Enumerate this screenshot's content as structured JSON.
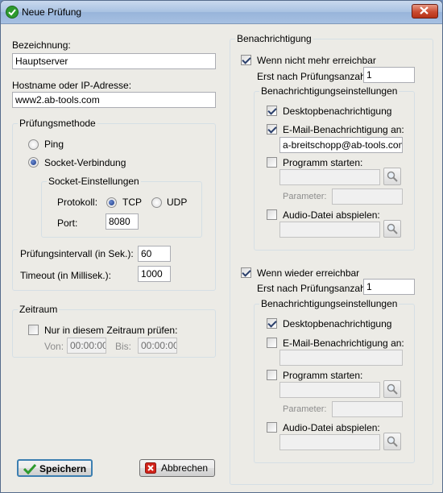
{
  "window": {
    "title": "Neue Prüfung"
  },
  "left": {
    "bezeichnung_label": "Bezeichnung:",
    "bezeichnung_value": "Hauptserver",
    "hostname_label": "Hostname oder IP-Adresse:",
    "hostname_value": "www2.ab-tools.com",
    "method_group": "Prüfungsmethode",
    "method_ping": "Ping",
    "method_socket": "Socket-Verbindung",
    "socket_group": "Socket-Einstellungen",
    "protokoll_label": "Protokoll:",
    "tcp": "TCP",
    "udp": "UDP",
    "port_label": "Port:",
    "port_value": "8080",
    "interval_label": "Prüfungsintervall (in Sek.):",
    "interval_value": "60",
    "timeout_label": "Timeout (in Millisek.):",
    "timeout_value": "1000",
    "zeitraum_group": "Zeitraum",
    "zeitraum_check": "Nur in diesem Zeitraum prüfen:",
    "von_label": "Von:",
    "von_value": "00:00:00",
    "bis_label": "Bis:",
    "bis_value": "00:00:00"
  },
  "right": {
    "group": "Benachrichtigung",
    "unreachable": {
      "check": "Wenn nicht mehr erreichbar",
      "after_label": "Erst nach Prüfungsanzahl:",
      "after_value": "1",
      "settings_group": "Benachrichtigungseinstellungen",
      "desktop": "Desktopbenachrichtigung",
      "email": "E-Mail-Benachrichtigung an:",
      "email_value": "a-breitschopp@ab-tools.com",
      "program": "Programm starten:",
      "parameter": "Parameter:",
      "audio": "Audio-Datei abspielen:"
    },
    "reachable": {
      "check": "Wenn wieder erreichbar",
      "after_label": "Erst nach Prüfungsanzahl:",
      "after_value": "1",
      "settings_group": "Benachrichtigungseinstellungen",
      "desktop": "Desktopbenachrichtigung",
      "email": "E-Mail-Benachrichtigung an:",
      "email_value": "",
      "program": "Programm starten:",
      "parameter": "Parameter:",
      "audio": "Audio-Datei abspielen:"
    }
  },
  "buttons": {
    "save": "Speichern",
    "cancel": "Abbrechen"
  },
  "icons": {
    "title": "check-circle-icon",
    "close": "close-icon",
    "browse": "magnifier-icon",
    "save": "checkmark-icon",
    "cancel": "cancel-icon"
  },
  "colors": {
    "accent": "#3c7fb1",
    "close": "#c94a2f",
    "check_green": "#2e9a2e",
    "cancel_red": "#d2231a"
  }
}
